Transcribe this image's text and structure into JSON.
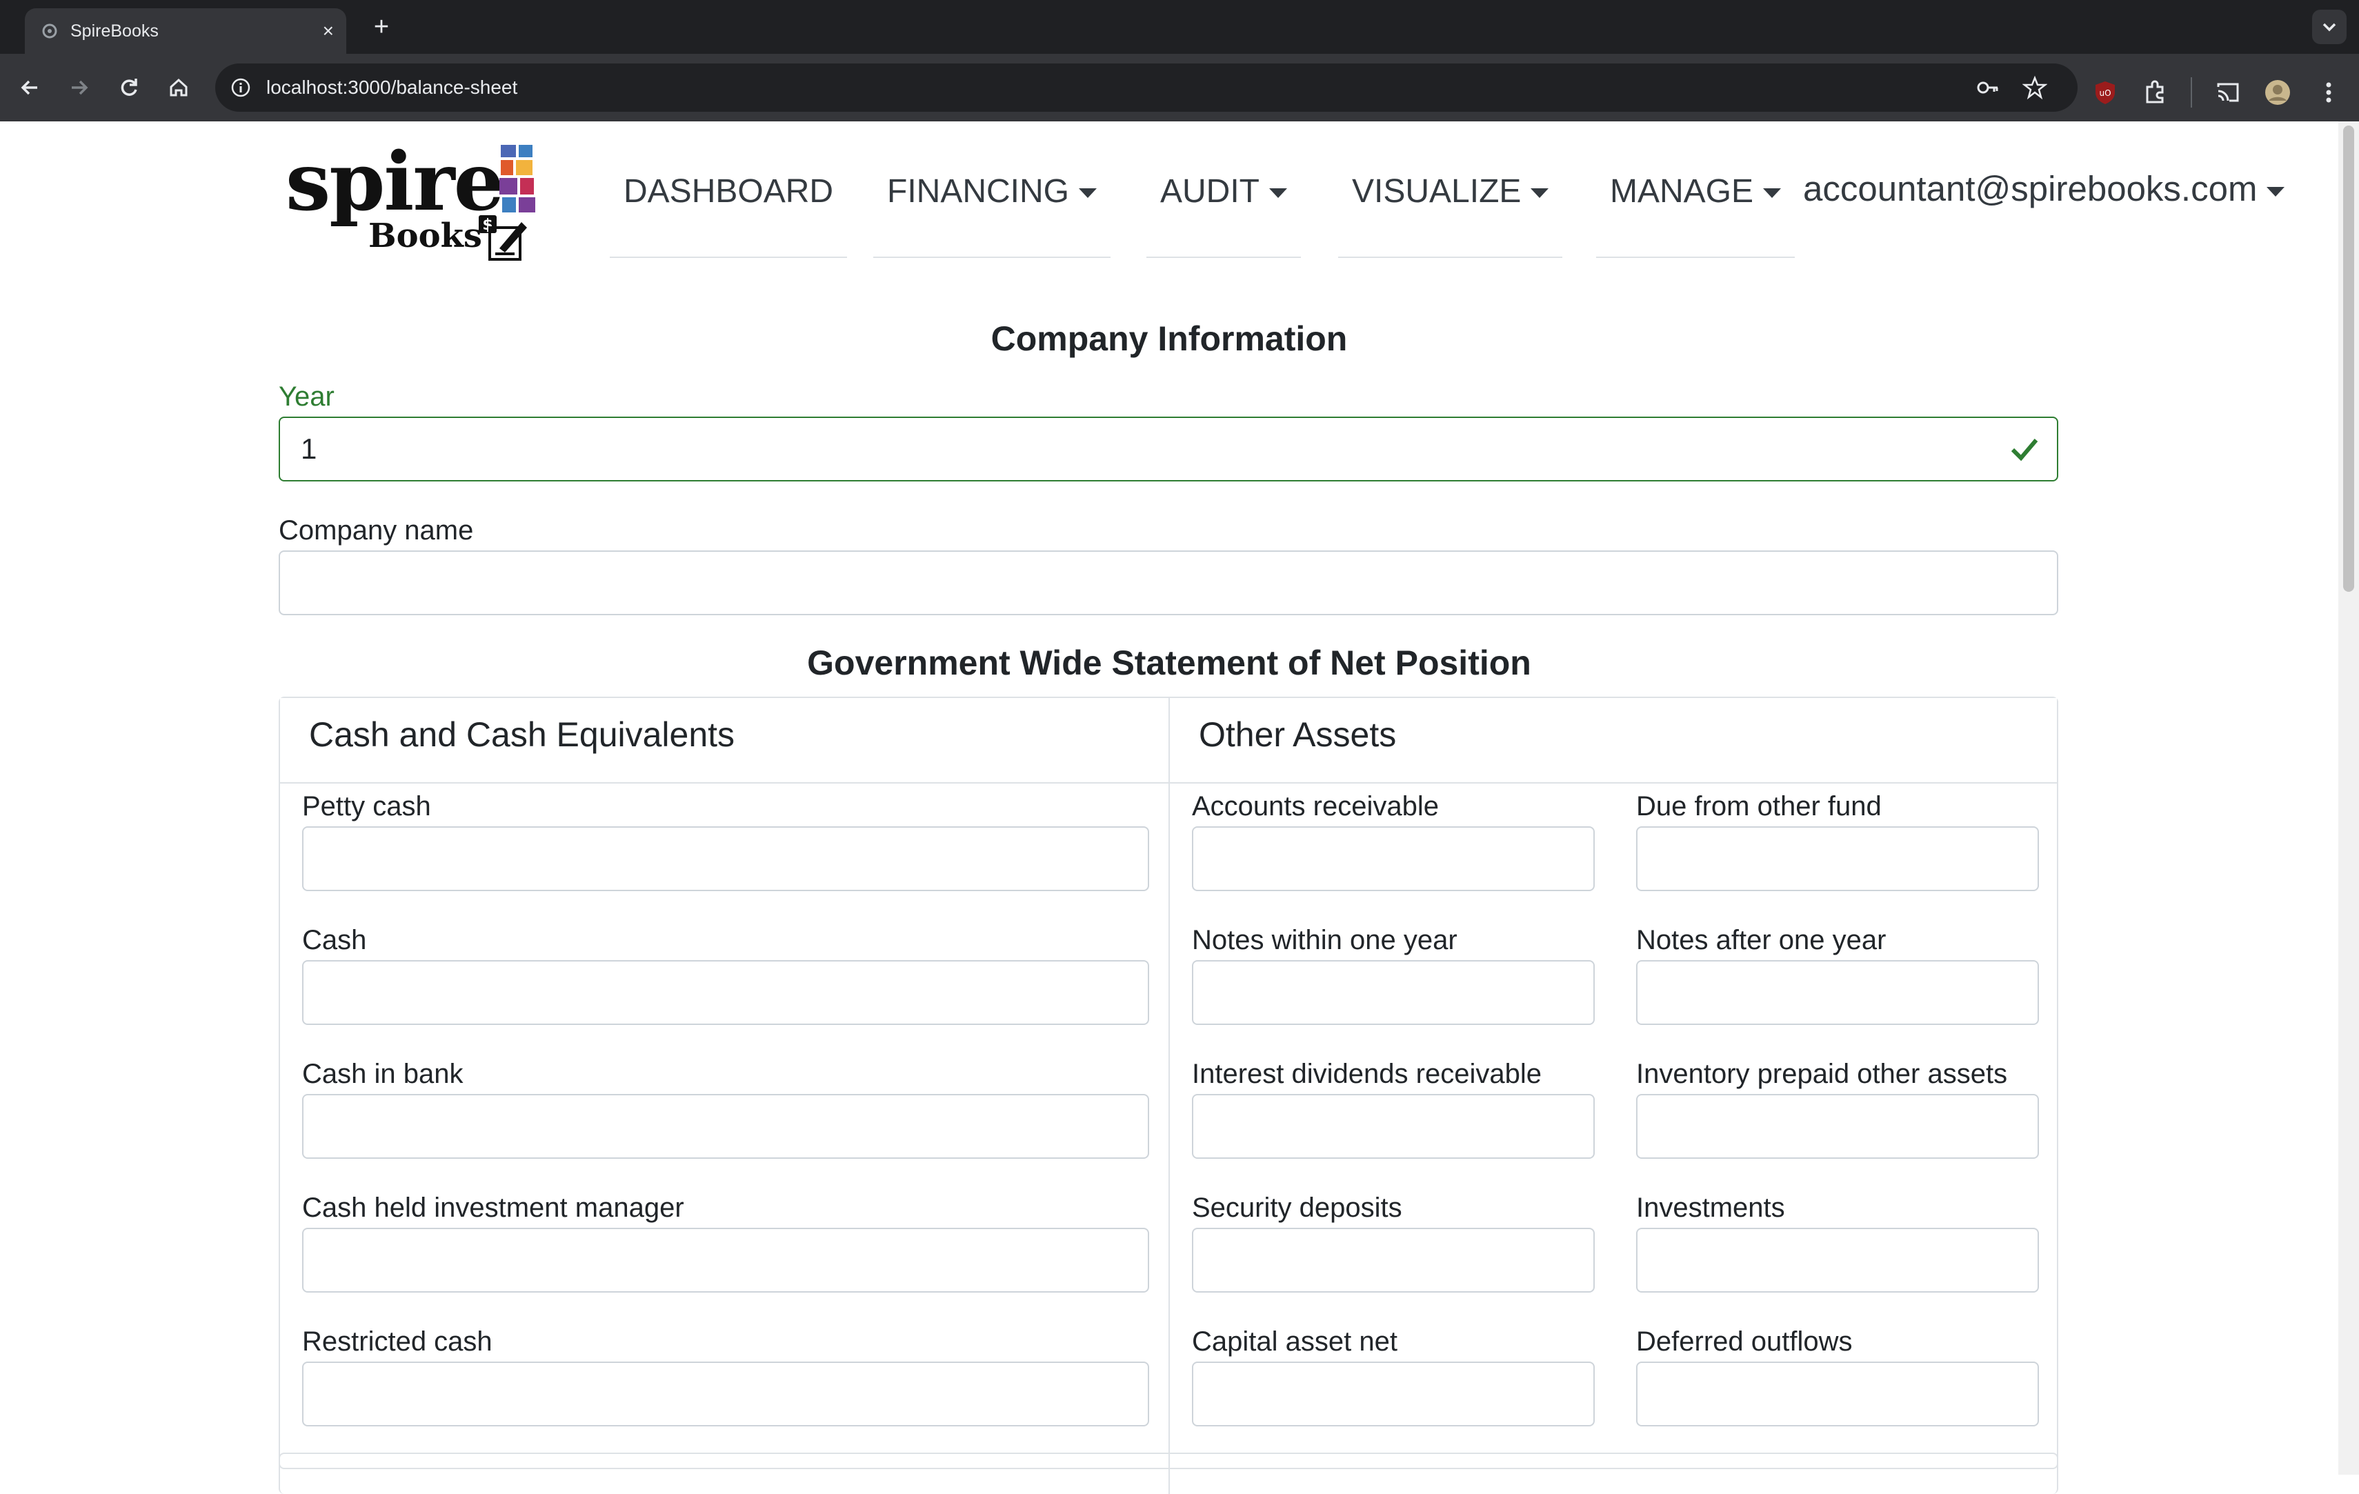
{
  "browser": {
    "tab_title": "SpireBooks",
    "tab_close": "×",
    "new_tab": "+",
    "url": "localhost:3000/balance-sheet"
  },
  "brand": {
    "logo_word": "spire",
    "logo_sub": "Books",
    "logo_colors": [
      "#4b67b5",
      "#e05a2b",
      "#f2b33d",
      "#7a3f98",
      "#c42f55",
      "#3d7fc1"
    ]
  },
  "nav": {
    "items": [
      {
        "label": "DASHBOARD",
        "has_caret": false
      },
      {
        "label": "FINANCING",
        "has_caret": true
      },
      {
        "label": "AUDIT",
        "has_caret": true
      },
      {
        "label": "VISUALIZE",
        "has_caret": true
      },
      {
        "label": "MANAGE",
        "has_caret": true
      }
    ],
    "account": "accountant@spirebooks.com"
  },
  "company": {
    "heading": "Company Information",
    "year_label": "Year",
    "year_value": "1",
    "name_label": "Company name",
    "name_value": ""
  },
  "statement": {
    "heading": "Government Wide Statement of Net Position",
    "cash_section": {
      "title": "Cash and Cash Equivalents",
      "fields": [
        "Petty cash",
        "Cash",
        "Cash in bank",
        "Cash held investment manager",
        "Restricted cash"
      ]
    },
    "other_section": {
      "title": "Other Assets",
      "fields_left": [
        "Accounts receivable",
        "Notes within one year",
        "Interest dividends receivable",
        "Security deposits",
        "Capital asset net"
      ],
      "fields_right": [
        "Due from other fund",
        "Notes after one year",
        "Inventory prepaid other assets",
        "Investments",
        "Deferred outflows"
      ]
    }
  },
  "colors": {
    "valid": "#2e7d32",
    "border": "#ced4da",
    "chrome_dark": "#1f2023",
    "chrome_toolbar": "#35363a"
  }
}
